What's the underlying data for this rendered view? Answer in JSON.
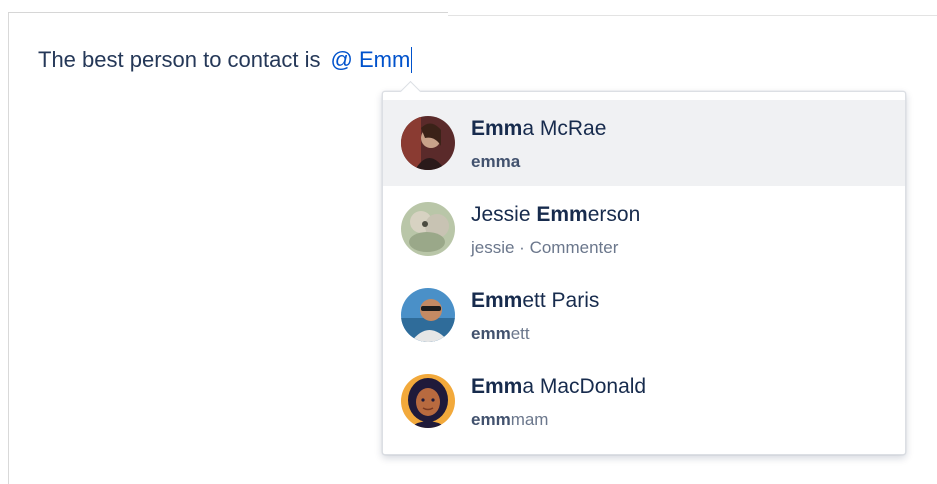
{
  "editor": {
    "text": "The best person to contact is",
    "mention_query": "@ Emm"
  },
  "suggestions": [
    {
      "name_match": "Emm",
      "name_rest": "a McRae",
      "name_prefix": "",
      "username_match": "emm",
      "username_rest": "a",
      "role": "",
      "selected": true,
      "avatar": "avatar-emma-mcrae"
    },
    {
      "name_prefix": "Jessie ",
      "name_match": "Emm",
      "name_rest": "erson",
      "username_match": "",
      "username_rest": "jessie · Commenter",
      "role": "Commenter",
      "selected": false,
      "avatar": "avatar-jessie-emmerson"
    },
    {
      "name_prefix": "",
      "name_match": "Emm",
      "name_rest": "ett Paris",
      "username_match": "emm",
      "username_rest": "ett",
      "role": "",
      "selected": false,
      "avatar": "avatar-emmett-paris"
    },
    {
      "name_prefix": "",
      "name_match": "Emm",
      "name_rest": "a MacDonald",
      "username_match": "emm",
      "username_rest": "mam",
      "role": "",
      "selected": false,
      "avatar": "avatar-emma-macdonald"
    }
  ],
  "colors": {
    "mention": "#0052cc",
    "text": "#253858",
    "selected_row": "#f0f1f3"
  }
}
